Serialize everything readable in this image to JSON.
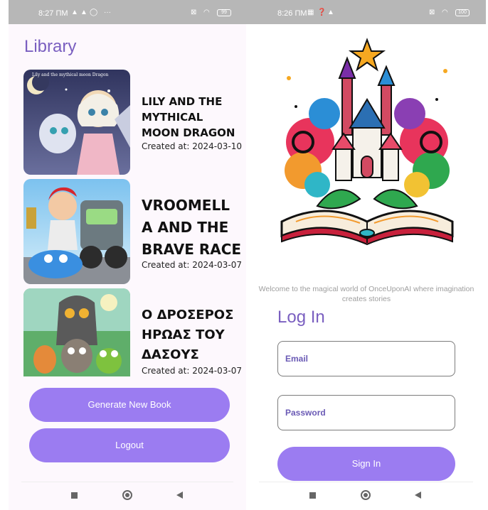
{
  "left_screen": {
    "status": {
      "time": "8:27 ΠΜ",
      "battery": "99"
    },
    "title": "Library",
    "books": [
      {
        "cover_text": "Lily and the mythical moon Dragon",
        "title_lines": [
          "LILY AND THE",
          "MYTHICAL",
          "MOON DRAGON"
        ],
        "created": "Created at: 2024-03-10"
      },
      {
        "title_lines": [
          "VROOMELL",
          "A AND THE",
          "BRAVE RACE"
        ],
        "created": "Created at: 2024-03-07"
      },
      {
        "title_lines": [
          "Ο ΔΡΟΣΕΡΟΣ",
          "ΗΡΩΑΣ ΤΟΥ",
          "ΔΑΣΟΥΣ"
        ],
        "created": "Created at: 2024-03-07"
      }
    ],
    "buttons": {
      "generate": "Generate New Book",
      "logout": "Logout"
    }
  },
  "right_screen": {
    "status": {
      "time": "8:26 ΠΜ",
      "battery": "100"
    },
    "welcome": "Welcome to the magical world of OnceUponAI where imagination creates stories",
    "login_title": "Log In",
    "email_placeholder": "Email",
    "password_placeholder": "Password",
    "sign_in": "Sign In"
  },
  "colors": {
    "accent": "#9b7cf1",
    "title": "#7a5fc0",
    "status_bar": "#b7b7b7"
  }
}
